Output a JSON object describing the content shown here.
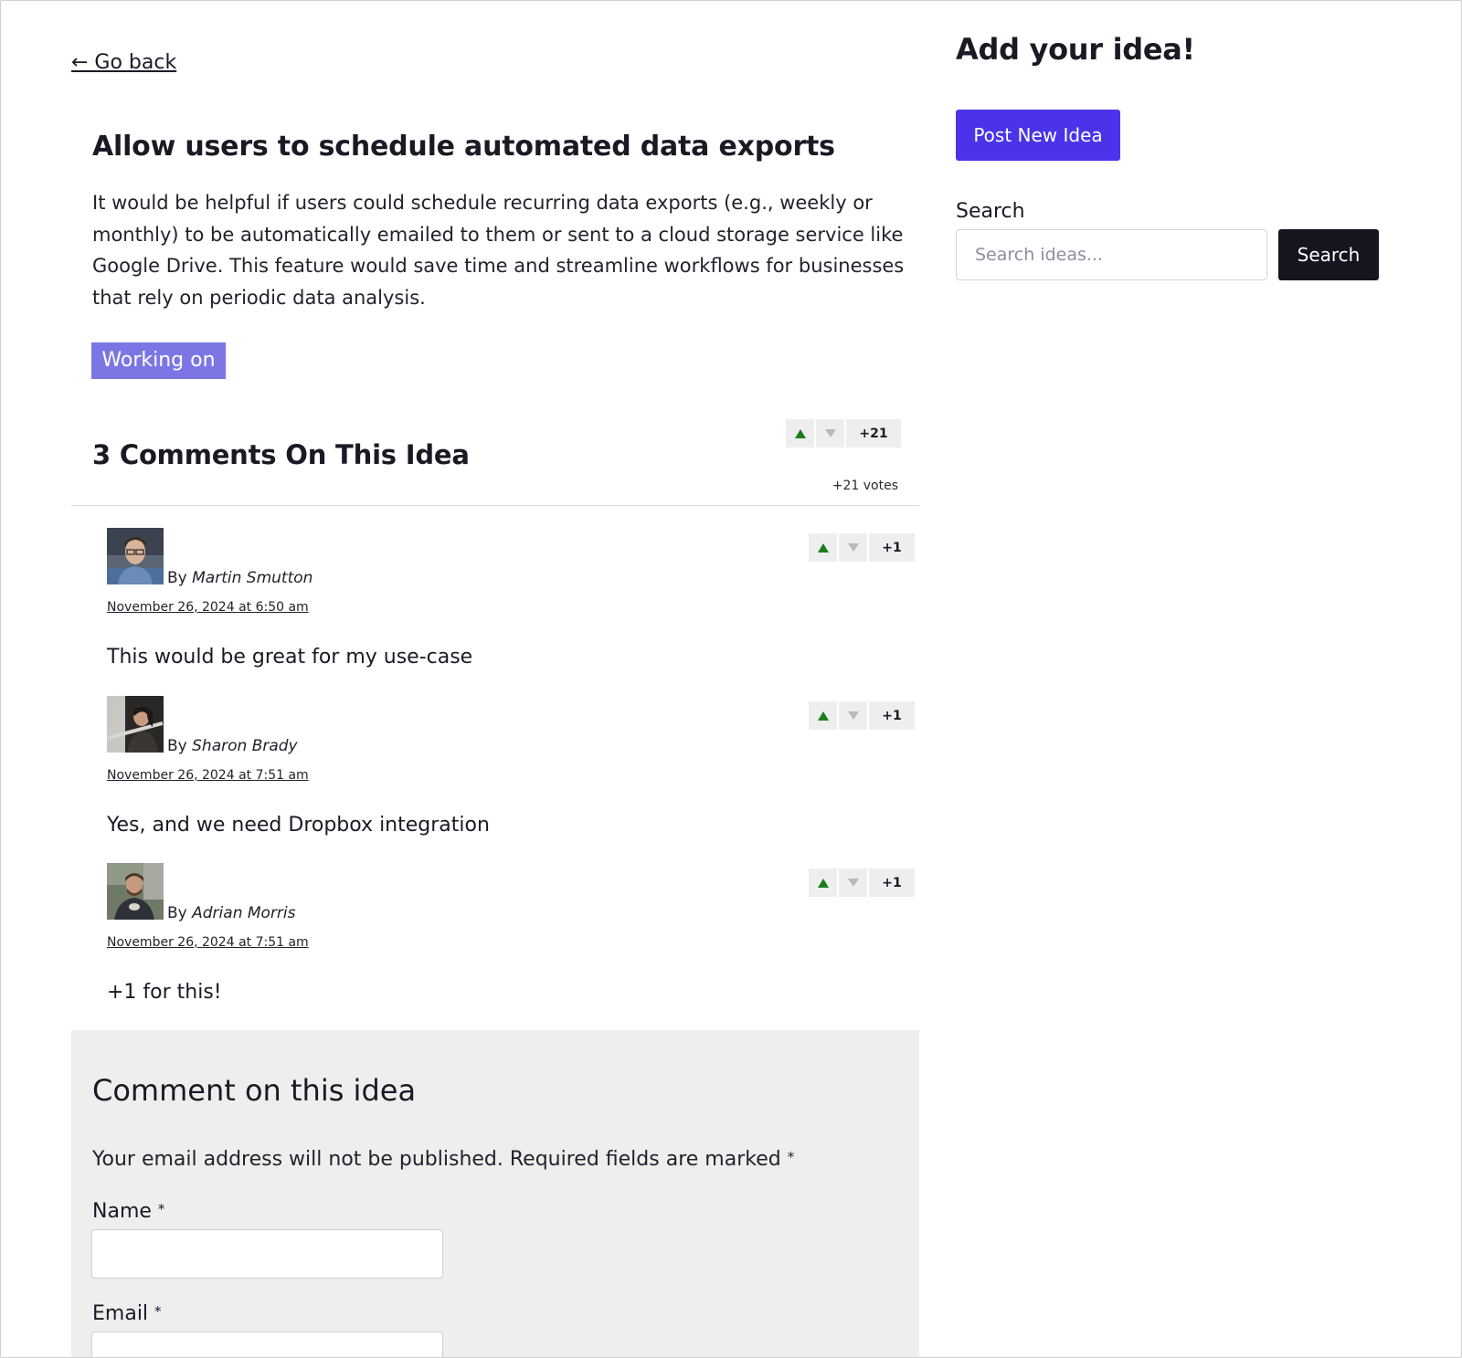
{
  "nav": {
    "go_back": "← Go back"
  },
  "idea": {
    "title": "Allow users to schedule automated data exports",
    "body": "It would be helpful if users could schedule recurring data exports (e.g., weekly or monthly) to be automatically emailed to them or sent to a cloud storage service like Google Drive. This feature would save time and streamline workflows for businesses that rely on periodic data analysis.",
    "status": "Working on",
    "vote_count": "+21",
    "votes_caption": "+21 votes"
  },
  "comments": {
    "heading": "3 Comments On This Idea",
    "items": [
      {
        "by": "By",
        "author": "Martin Smutton",
        "date": "November 26, 2024 at 6:50 am",
        "text": "This would be great for my use-case",
        "votes": "+1"
      },
      {
        "by": "By",
        "author": "Sharon Brady",
        "date": "November 26, 2024 at 7:51 am",
        "text": "Yes, and we need Dropbox integration",
        "votes": "+1"
      },
      {
        "by": "By",
        "author": "Adrian Morris",
        "date": "November 26, 2024 at 7:51 am",
        "text": "+1 for this!",
        "votes": "+1"
      }
    ]
  },
  "form": {
    "title": "Comment on this idea",
    "notice": "Your email address will not be published. Required fields are marked",
    "required_mark": "*",
    "name_label": "Name",
    "email_label": "Email"
  },
  "sidebar": {
    "title": "Add your idea!",
    "post_button": "Post New Idea",
    "search_label": "Search",
    "search_placeholder": "Search ideas...",
    "search_button": "Search"
  },
  "colors": {
    "accent": "#4a33e8",
    "status_badge": "#7b76e3",
    "upvote": "#1a7f1a",
    "downvote": "#b9b9b9",
    "search_button": "#16141f",
    "form_panel": "#eeeeee"
  },
  "icons": [
    "upvote-arrow-icon",
    "downvote-arrow-icon",
    "avatar-photo"
  ]
}
